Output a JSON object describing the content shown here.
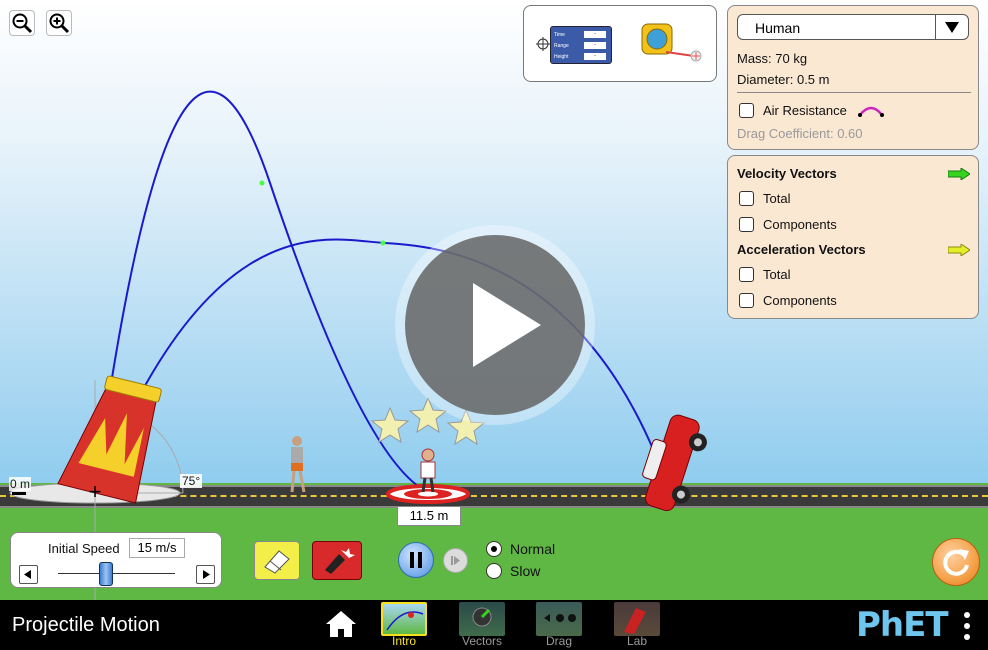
{
  "zoom": {
    "out_icon": "zoom-out-icon",
    "in_icon": "zoom-in-icon"
  },
  "tools": {
    "readout_rows": [
      "Time",
      "Range",
      "Height"
    ],
    "readout_values": [
      "-",
      "-",
      "-"
    ]
  },
  "projectile": {
    "selected": "Human",
    "mass": "Mass: 70 kg",
    "diameter": "Diameter: 0.5 m",
    "air_resistance_label": "Air Resistance",
    "air_resistance_checked": false,
    "drag": "Drag Coefficient: 0.60"
  },
  "vectors": {
    "velocity_title": "Velocity Vectors",
    "velocity_color": "#36d41e",
    "acceleration_title": "Acceleration Vectors",
    "acceleration_color": "#e6ee2a",
    "total_label": "Total",
    "components_label": "Components",
    "velocity_total_checked": false,
    "velocity_components_checked": false,
    "acceleration_total_checked": false,
    "acceleration_components_checked": false
  },
  "scene": {
    "height_label": "0 m",
    "angle_label": "75°",
    "target_label": "11.5 m",
    "stars": 3
  },
  "speed": {
    "label": "Initial Speed",
    "value": "15 m/s",
    "level": 0.4
  },
  "playback": {
    "normal": "Normal",
    "slow": "Slow",
    "selected": "Normal",
    "is_playing": true
  },
  "colors": {
    "trajectory": "#1a1acc",
    "panel_bg": "#fbe8d3",
    "grass": "#5fb844",
    "reset": "#f5a14a"
  },
  "nav": {
    "app_title": "Projectile Motion",
    "screens": [
      {
        "label": "Intro",
        "selected": true
      },
      {
        "label": "Vectors",
        "selected": false
      },
      {
        "label": "Drag",
        "selected": false
      },
      {
        "label": "Lab",
        "selected": false
      }
    ],
    "brand": "PhET"
  }
}
